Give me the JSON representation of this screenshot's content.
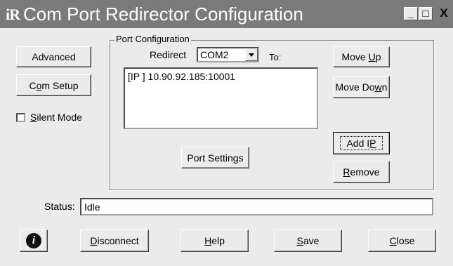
{
  "window": {
    "logo_text": "iR",
    "title": "Com Port Redirector Configuration",
    "minimize_glyph": "_",
    "maximize_glyph": "□",
    "close_glyph": "X"
  },
  "left_panel": {
    "advanced_label": "Advanced",
    "com_setup_label_pre": "C",
    "com_setup_label_ul": "o",
    "com_setup_label_post": "m Setup",
    "silent_mode_ul": "S",
    "silent_mode_post": "ilent Mode",
    "silent_mode_checked": false
  },
  "port_config": {
    "legend": "Port Configuration",
    "redirect_label": "Redirect",
    "selected_port": "COM2",
    "to_label": "To:",
    "entries": [
      "[IP ]  10.90.92.185:10001"
    ],
    "port_settings_label": "Port Settings",
    "move_up_pre": "Move ",
    "move_up_ul": "U",
    "move_up_post": "p",
    "move_down_pre": "Move Do",
    "move_down_ul": "w",
    "move_down_post": "n",
    "add_ip_pre": "Add I",
    "add_ip_ul": "P",
    "remove_ul": "R",
    "remove_post": "emove"
  },
  "status": {
    "label": "Status:",
    "value": "Idle"
  },
  "bottom_bar": {
    "info_icon": "info-icon",
    "disconnect_ul": "D",
    "disconnect_post": "isconnect",
    "help_ul": "H",
    "help_post": "elp",
    "save_ul": "S",
    "save_post": "ave",
    "close_ul": "C",
    "close_post": "lose"
  }
}
